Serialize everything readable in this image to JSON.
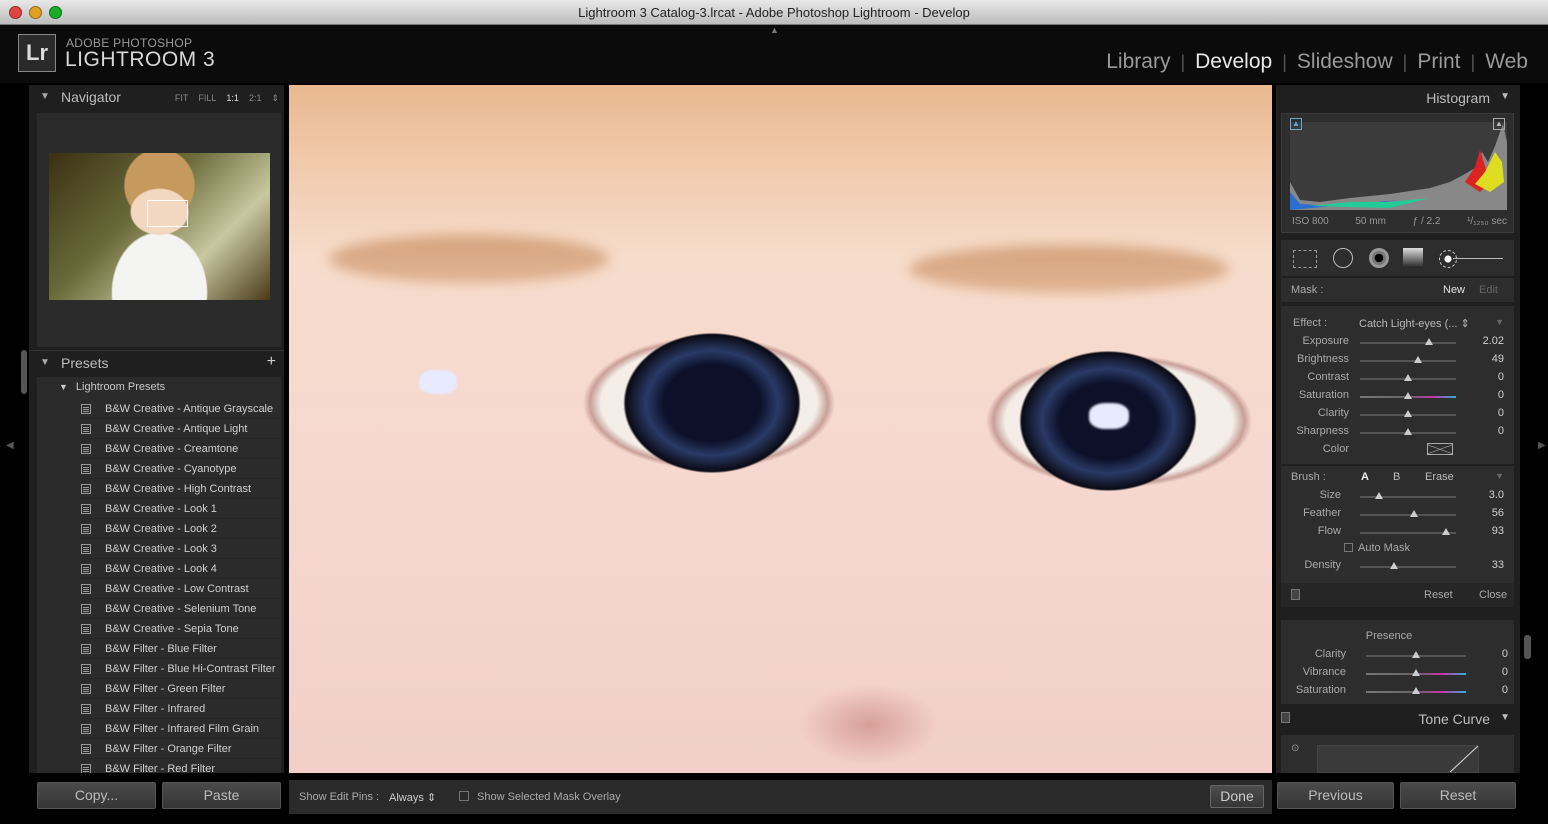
{
  "window": {
    "title": "Lightroom 3 Catalog-3.lrcat - Adobe Photoshop Lightroom - Develop"
  },
  "brand": {
    "logo": "Lr",
    "line1": "ADOBE PHOTOSHOP",
    "line2": "LIGHTROOM 3"
  },
  "modules": [
    {
      "label": "Library",
      "active": false
    },
    {
      "label": "Develop",
      "active": true
    },
    {
      "label": "Slideshow",
      "active": false
    },
    {
      "label": "Print",
      "active": false
    },
    {
      "label": "Web",
      "active": false
    }
  ],
  "navigator": {
    "title": "Navigator",
    "zoom": [
      "FIT",
      "FILL",
      "1:1",
      "2:1"
    ]
  },
  "presets": {
    "title": "Presets",
    "group": "Lightroom Presets",
    "items": [
      "B&W Creative - Antique Grayscale",
      "B&W Creative - Antique Light",
      "B&W Creative - Creamtone",
      "B&W Creative - Cyanotype",
      "B&W Creative - High Contrast",
      "B&W Creative - Look 1",
      "B&W Creative - Look 2",
      "B&W Creative - Look 3",
      "B&W Creative - Look 4",
      "B&W Creative - Low Contrast",
      "B&W Creative - Selenium Tone",
      "B&W Creative - Sepia Tone",
      "B&W Filter - Blue Filter",
      "B&W Filter - Blue Hi-Contrast Filter",
      "B&W Filter - Green Filter",
      "B&W Filter - Infrared",
      "B&W Filter - Infrared Film Grain",
      "B&W Filter - Orange Filter",
      "B&W Filter - Red Filter"
    ]
  },
  "left_buttons": {
    "copy": "Copy...",
    "paste": "Paste"
  },
  "toolbar": {
    "pins_label": "Show Edit Pins :",
    "pins_value": "Always",
    "overlay_label": "Show Selected Mask Overlay",
    "done": "Done"
  },
  "histogram": {
    "title": "Histogram",
    "iso": "ISO 800",
    "focal": "50 mm",
    "aperture": "ƒ / 2.2",
    "shutter": "¹/₁₂₅₀ sec"
  },
  "mask": {
    "label": "Mask :",
    "new": "New",
    "edit": "Edit"
  },
  "effect": {
    "label": "Effect :",
    "preset": "Catch Light-eyes (...",
    "sliders": [
      {
        "label": "Exposure",
        "value": "2.02",
        "pos": 0.72
      },
      {
        "label": "Brightness",
        "value": "49",
        "pos": 0.6
      },
      {
        "label": "Contrast",
        "value": "0",
        "pos": 0.5
      },
      {
        "label": "Saturation",
        "value": "0",
        "pos": 0.5
      },
      {
        "label": "Clarity",
        "value": "0",
        "pos": 0.5
      },
      {
        "label": "Sharpness",
        "value": "0",
        "pos": 0.5
      }
    ],
    "color_label": "Color"
  },
  "brush": {
    "label": "Brush :",
    "a": "A",
    "b": "B",
    "erase": "Erase",
    "sliders": [
      {
        "label": "Size",
        "value": "3.0",
        "pos": 0.2
      },
      {
        "label": "Feather",
        "value": "56",
        "pos": 0.56
      },
      {
        "label": "Flow",
        "value": "93",
        "pos": 0.9
      }
    ],
    "automask": "Auto Mask",
    "density": {
      "label": "Density",
      "value": "33",
      "pos": 0.35
    },
    "reset": "Reset",
    "close": "Close"
  },
  "presence": {
    "title": "Presence",
    "sliders": [
      {
        "label": "Clarity",
        "value": "0",
        "pos": 0.5
      },
      {
        "label": "Vibrance",
        "value": "0",
        "pos": 0.5
      },
      {
        "label": "Saturation",
        "value": "0",
        "pos": 0.5
      }
    ]
  },
  "tone_curve": {
    "title": "Tone Curve"
  },
  "right_buttons": {
    "previous": "Previous",
    "reset": "Reset"
  },
  "colors": {
    "panel": "#1f1f1f",
    "panel_light": "#2d2d2d",
    "active_module": "#e8e8e8"
  }
}
